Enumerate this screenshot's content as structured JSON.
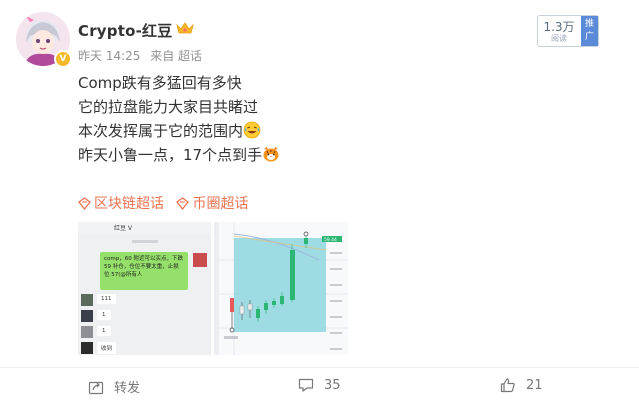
{
  "user": {
    "name": "Crypto-红豆",
    "badge": "V"
  },
  "meta": {
    "time": "昨天 14:25",
    "source": "来自 超话"
  },
  "views": {
    "count": "1.3万",
    "label": "阅读",
    "push_label": "推广"
  },
  "post": {
    "lines": [
      "Comp跌有多猛回有多快",
      "它的拉盘能力大家目共睹过",
      "本次发挥属于它的范围内",
      "昨天小鲁一点，17个点到手"
    ]
  },
  "topics": [
    "区块链超话",
    "币圈超话"
  ],
  "chat_image": {
    "header": "红豆 V",
    "bubble_text": "comp，60 附近可以买点，下跌 59 补仓，仓位不要太重，止损位 57(@所有人",
    "replies": [
      "111",
      "1",
      "1",
      "收到"
    ]
  },
  "chart_image": {
    "price_tag": "59.44"
  },
  "actions": {
    "repost": "转发",
    "comments": "35",
    "likes": "21"
  },
  "colors": {
    "topic": "#eb7350",
    "badge": "#f6b928"
  }
}
